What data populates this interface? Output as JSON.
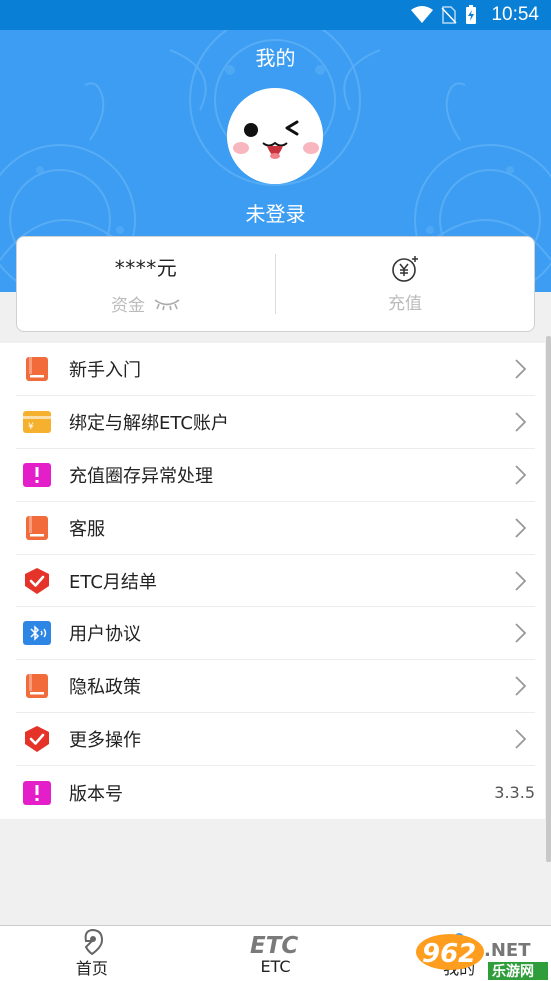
{
  "status_bar": {
    "time": "10:54"
  },
  "header": {
    "title": "我的",
    "login_text": "未登录"
  },
  "account_card": {
    "balance": "****元",
    "balance_label": "资金",
    "recharge_label": "充值"
  },
  "menu": {
    "items": [
      {
        "label": "新手入门",
        "icon": "book-icon",
        "color": "#f26b3a"
      },
      {
        "label": "绑定与解绑ETC账户",
        "icon": "card-icon",
        "color": "#f5b02e"
      },
      {
        "label": "充值圈存异常处理",
        "icon": "alert-icon",
        "color": "#e41ec8"
      },
      {
        "label": "客服",
        "icon": "book-icon",
        "color": "#f26b3a"
      },
      {
        "label": "ETC月结单",
        "icon": "shield-check-icon",
        "color": "#e5332a"
      },
      {
        "label": "用户协议",
        "icon": "bluetooth-icon",
        "color": "#2d86e3"
      },
      {
        "label": "隐私政策",
        "icon": "book-icon",
        "color": "#f26b3a"
      },
      {
        "label": "更多操作",
        "icon": "shield-check-icon",
        "color": "#e5332a"
      },
      {
        "label": "版本号",
        "icon": "alert-icon",
        "color": "#e41ec8",
        "value": "3.3.5"
      }
    ]
  },
  "bottom_nav": {
    "items": [
      {
        "label": "首页",
        "icon": "location-icon"
      },
      {
        "label": "ETC",
        "icon": "etc-logo-icon"
      },
      {
        "label": "我的",
        "icon": "user-icon"
      }
    ]
  },
  "watermark": {
    "text": "乐游网",
    "logo": "962.NET"
  }
}
